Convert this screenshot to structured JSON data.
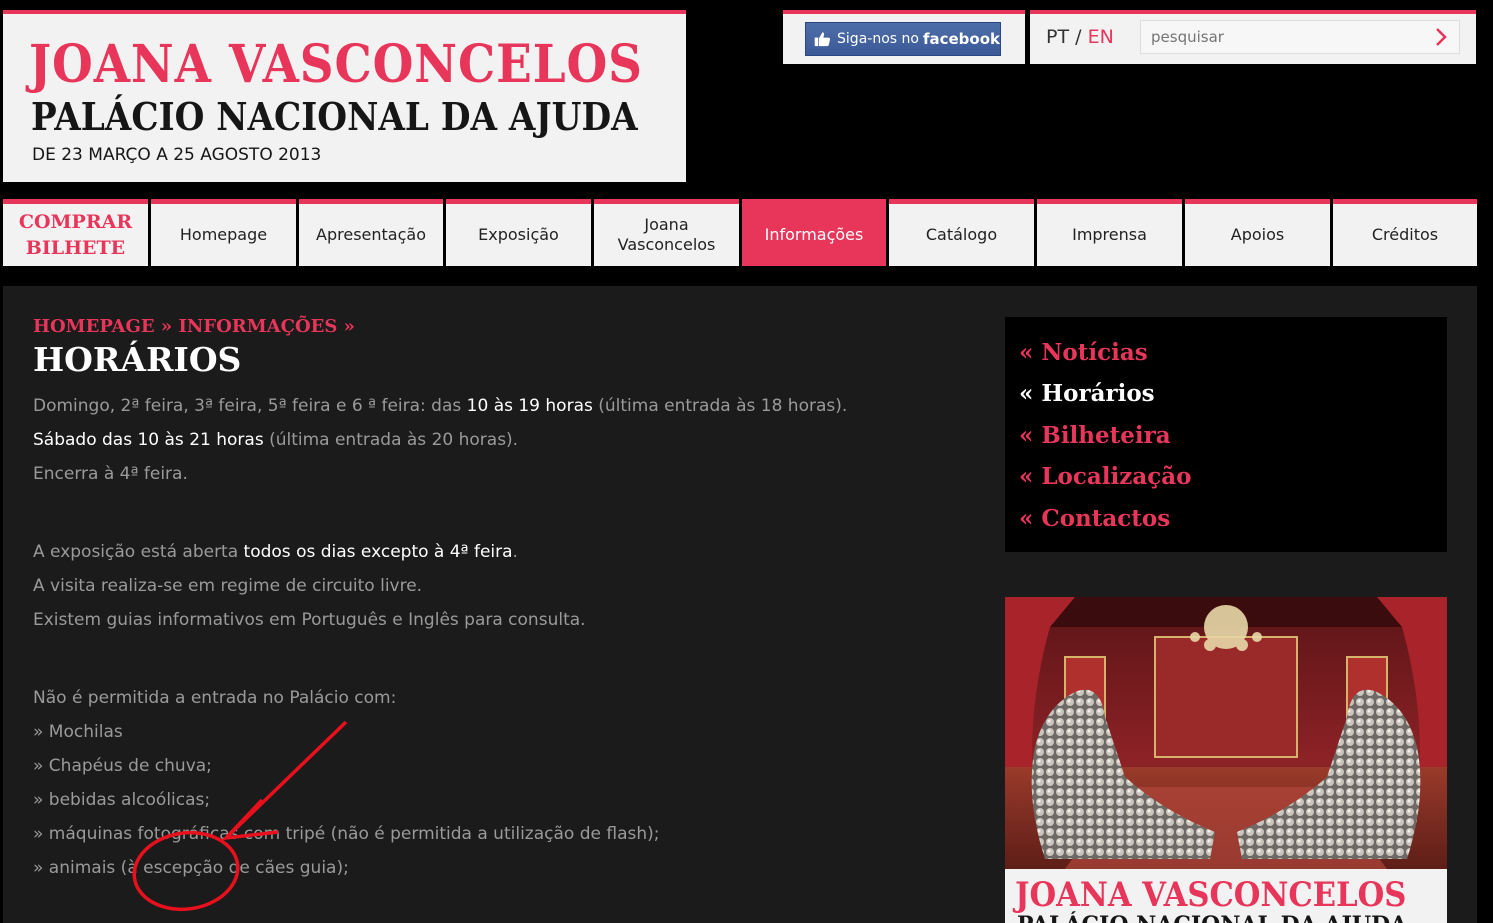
{
  "header": {
    "logo_line1": "JOANA VASCONCELOS",
    "logo_line2": "PALÁCIO NACIONAL DA AJUDA",
    "logo_line3": "DE 23 MARÇO A 25 AGOSTO 2013",
    "facebook_text": "Siga-nos no",
    "facebook_brand": "facebook",
    "lang_pt": "PT",
    "lang_sep": "/",
    "lang_en": "EN",
    "search_placeholder": "pesquisar"
  },
  "nav": {
    "buy_line1": "COMPRAR",
    "buy_line2": "BILHETE",
    "items": [
      {
        "label": "Homepage"
      },
      {
        "label": "Apresentação"
      },
      {
        "label": "Exposição"
      },
      {
        "label_line1": "Joana",
        "label_line2": "Vasconcelos"
      },
      {
        "label": "Informações"
      },
      {
        "label": "Catálogo"
      },
      {
        "label": "Imprensa"
      },
      {
        "label": "Apoios"
      },
      {
        "label": "Créditos"
      }
    ]
  },
  "breadcrumb": {
    "home": "HOMEPAGE",
    "sep": "»",
    "section": "INFORMAÇÕES",
    "sep2": "»"
  },
  "page_title": "HORÁRIOS",
  "content": {
    "p1_a": "Domingo, 2ª feira, 3ª feira, 5ª feira e 6 ª feira: das ",
    "p1_b": "10 às 19 horas",
    "p1_c": " (última entrada às 18 horas).",
    "p2_a": "Sábado das 10 às 21 horas",
    "p2_b": " (última entrada às 20 horas).",
    "p3": "Encerra à 4ª feira.",
    "p4_a": "A exposição está aberta ",
    "p4_b": "todos os dias excepto à 4ª feira",
    "p4_c": ".",
    "p5": "A visita realiza-se em regime de circuito livre.",
    "p6": "Existem guias informativos em Português e Inglês para consulta.",
    "p7": "Não é permitida a entrada no Palácio com:",
    "list": [
      "» Mochilas",
      "» Chapéus de chuva;",
      "» bebidas alcoólicas;",
      "» máquinas fotográficas com tripé (não é permitida a utilização de flash);",
      "» animais (à escepção de cães guia);"
    ]
  },
  "sidebar": {
    "items": [
      {
        "label": "« Notícias"
      },
      {
        "label": "« Horários"
      },
      {
        "label": "« Bilheteira"
      },
      {
        "label": "« Localização"
      },
      {
        "label": "« Contactos"
      }
    ]
  },
  "promo": {
    "line1": "JOANA VASCONCELOS",
    "line2": "PALÁCIO NACIONAL DA AJUDA"
  },
  "colors": {
    "accent": "#e8355a",
    "background": "#000000",
    "content_bg": "#1b1b1b",
    "panel": "#f2f2f2"
  }
}
